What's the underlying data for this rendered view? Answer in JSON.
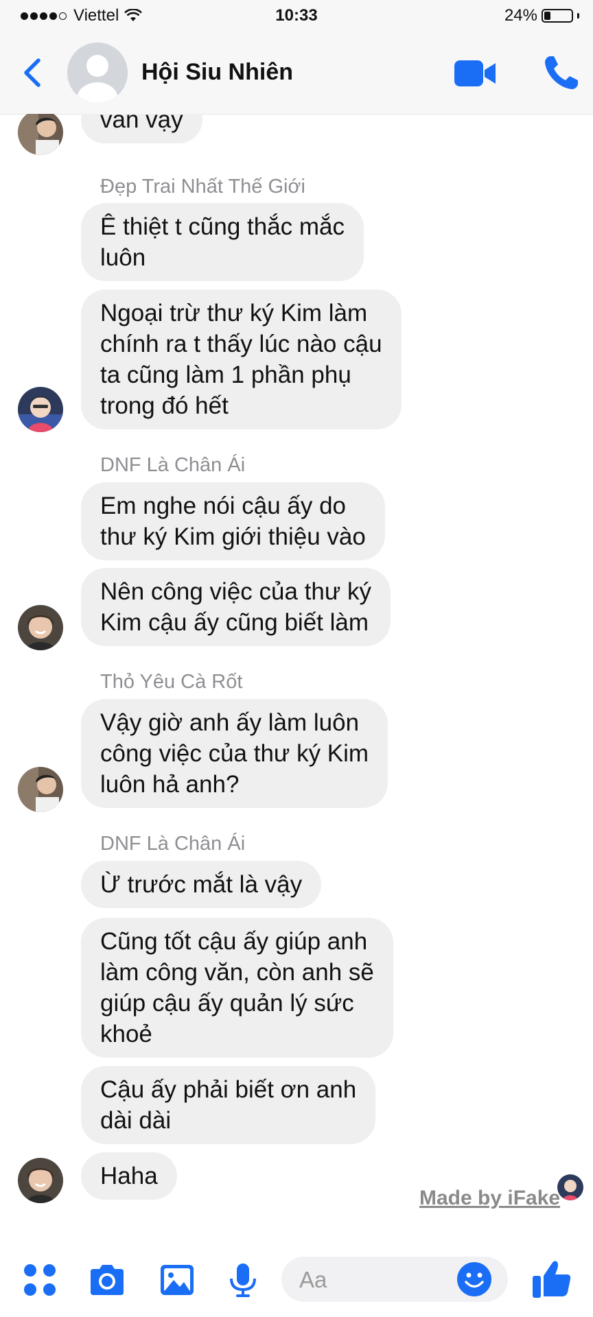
{
  "status_bar": {
    "carrier": "Viettel",
    "time": "10:33",
    "battery": "24%",
    "battery_level": 0.24
  },
  "header": {
    "title": "Hội Siu Nhiên",
    "icons": [
      "back-icon",
      "group-avatar",
      "video-camera-icon",
      "phone-icon"
    ]
  },
  "messages": [
    {
      "sender": "",
      "text": "văn vậy"
    },
    {
      "sender": "Đẹp Trai Nhất Thế Giới",
      "text": "Ê thiệt t cũng thắc mắc\nluôn"
    },
    {
      "sender": "",
      "text": "Ngoại trừ thư ký Kim làm\nchính ra t thấy lúc nào cậu\nta cũng làm 1 phần phụ\ntrong đó hết"
    },
    {
      "sender": "DNF Là Chân Ái",
      "text": "Em nghe nói cậu ấy do\nthư ký Kim giới thiệu vào"
    },
    {
      "sender": "",
      "text": "Nên công việc của thư ký\nKim cậu ấy cũng biết làm"
    },
    {
      "sender": "Thỏ Yêu Cà Rốt",
      "text": "Vậy giờ anh ấy làm luôn\ncông việc của thư ký Kim\nluôn hả anh?"
    },
    {
      "sender": "DNF Là Chân Ái",
      "text": "Ừ trước mắt là vậy"
    },
    {
      "sender": "",
      "text": "Cũng tốt cậu ấy giúp anh\nlàm công văn, còn anh sẽ\ngiúp cậu ấy quản lý sức\nkhoẻ"
    },
    {
      "sender": "",
      "text": "Cậu ấy phải biết ơn anh\ndài dài"
    },
    {
      "sender": "",
      "text": "Haha"
    }
  ],
  "watermark": "Made by iFake",
  "composer": {
    "placeholder": "Aa",
    "icons": [
      "apps-icon",
      "camera-icon",
      "photo-icon",
      "microphone-icon",
      "emoji-icon",
      "like-icon"
    ]
  },
  "colors": {
    "accent": "#1a6ef5",
    "bubble": "#efefef",
    "sender": "#8e8e93"
  }
}
